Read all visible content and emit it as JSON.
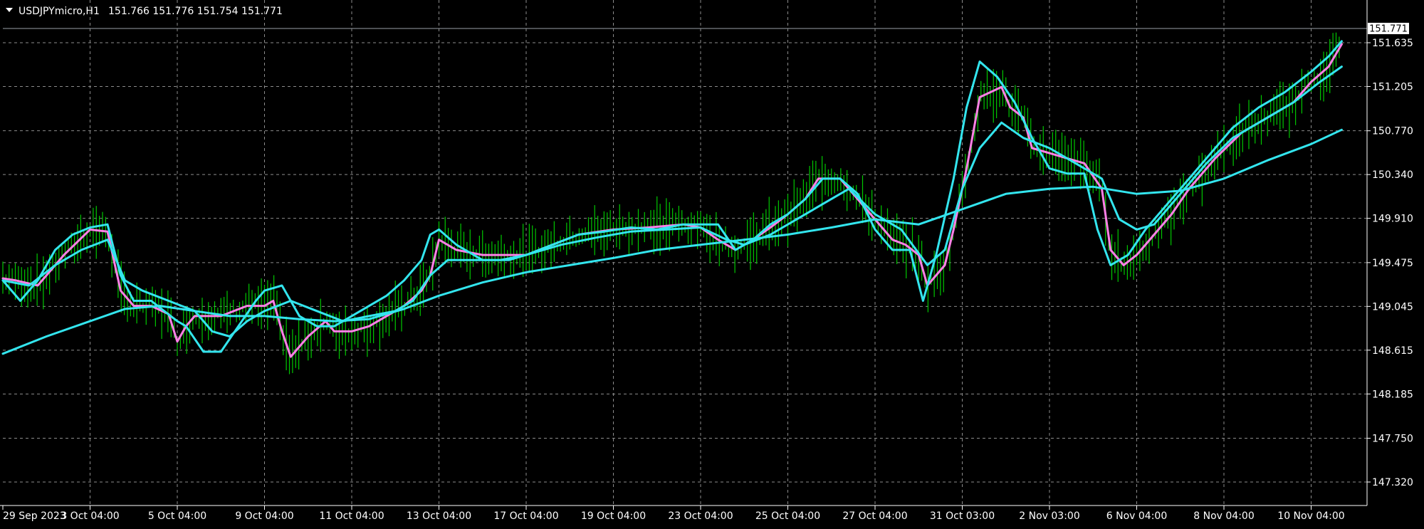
{
  "header": {
    "menu_icon": "triangle-down-icon",
    "symbol": "USDJPYmicro,H1",
    "ohlc": "151.766 151.776 151.754 151.771"
  },
  "price_tag": "151.771",
  "colors": {
    "background": "#000000",
    "grid": "#8c8c8c",
    "bars": "#00c800",
    "ma_fast": "#ff80e6",
    "ma_cyan": "#33e5ee",
    "axis_text": "#ffffff"
  },
  "chart_data": {
    "type": "line",
    "title": "USDJPYmicro,H1",
    "x_tick_labels": [
      "29 Sep 2023",
      "3 Oct 04:00",
      "5 Oct 04:00",
      "9 Oct 04:00",
      "11 Oct 04:00",
      "13 Oct 04:00",
      "17 Oct 04:00",
      "19 Oct 04:00",
      "23 Oct 04:00",
      "25 Oct 04:00",
      "27 Oct 04:00",
      "31 Oct 03:00",
      "2 Nov 03:00",
      "6 Nov 04:00",
      "8 Nov 04:00",
      "10 Nov 04:00"
    ],
    "y_tick_labels": [
      "151.635",
      "151.205",
      "150.770",
      "150.340",
      "149.910",
      "149.475",
      "149.045",
      "148.615",
      "148.185",
      "147.750",
      "147.320"
    ],
    "ylim": [
      147.16,
      151.95
    ],
    "last_price": 151.771,
    "grid": true,
    "series": [
      {
        "style": "line",
        "color": "#ff80e6",
        "points": [
          [
            0.0,
            149.32
          ],
          [
            0.15,
            149.3
          ],
          [
            0.4,
            149.25
          ],
          [
            0.7,
            149.55
          ],
          [
            1.0,
            149.8
          ],
          [
            1.2,
            149.78
          ],
          [
            1.35,
            149.2
          ],
          [
            1.5,
            149.05
          ],
          [
            1.7,
            149.05
          ],
          [
            1.9,
            148.97
          ],
          [
            2.0,
            148.7
          ],
          [
            2.1,
            148.85
          ],
          [
            2.2,
            148.95
          ],
          [
            2.5,
            148.95
          ],
          [
            2.8,
            149.05
          ],
          [
            3.0,
            149.05
          ],
          [
            3.1,
            149.1
          ],
          [
            3.2,
            148.8
          ],
          [
            3.3,
            148.55
          ],
          [
            3.5,
            148.75
          ],
          [
            3.7,
            148.9
          ],
          [
            3.8,
            148.8
          ],
          [
            4.0,
            148.8
          ],
          [
            4.2,
            148.85
          ],
          [
            4.4,
            148.95
          ],
          [
            4.6,
            149.05
          ],
          [
            4.8,
            149.2
          ],
          [
            4.9,
            149.35
          ],
          [
            5.0,
            149.7
          ],
          [
            5.2,
            149.6
          ],
          [
            5.5,
            149.55
          ],
          [
            5.8,
            149.55
          ],
          [
            6.0,
            149.55
          ],
          [
            6.3,
            149.65
          ],
          [
            6.6,
            149.75
          ],
          [
            7.0,
            149.8
          ],
          [
            7.4,
            149.82
          ],
          [
            7.8,
            149.85
          ],
          [
            8.0,
            149.82
          ],
          [
            8.2,
            149.7
          ],
          [
            8.4,
            149.6
          ],
          [
            8.6,
            149.7
          ],
          [
            8.8,
            149.82
          ],
          [
            9.0,
            149.95
          ],
          [
            9.2,
            150.1
          ],
          [
            9.35,
            150.3
          ],
          [
            9.6,
            150.3
          ],
          [
            9.8,
            150.1
          ],
          [
            10.0,
            149.9
          ],
          [
            10.2,
            149.7
          ],
          [
            10.35,
            149.65
          ],
          [
            10.5,
            149.55
          ],
          [
            10.6,
            149.25
          ],
          [
            10.8,
            149.45
          ],
          [
            10.9,
            149.8
          ],
          [
            11.05,
            150.4
          ],
          [
            11.2,
            151.1
          ],
          [
            11.45,
            151.2
          ],
          [
            11.55,
            151.0
          ],
          [
            11.7,
            150.9
          ],
          [
            11.8,
            150.6
          ],
          [
            12.0,
            150.55
          ],
          [
            12.2,
            150.5
          ],
          [
            12.4,
            150.45
          ],
          [
            12.6,
            150.2
          ],
          [
            12.7,
            149.6
          ],
          [
            12.85,
            149.45
          ],
          [
            13.0,
            149.55
          ],
          [
            13.2,
            149.75
          ],
          [
            13.4,
            149.95
          ],
          [
            13.6,
            150.2
          ],
          [
            13.9,
            150.5
          ],
          [
            14.2,
            150.75
          ],
          [
            14.5,
            150.9
          ],
          [
            14.8,
            151.05
          ],
          [
            15.0,
            151.25
          ],
          [
            15.2,
            151.4
          ],
          [
            15.35,
            151.62
          ]
        ]
      },
      {
        "style": "line",
        "color": "#33e5ee",
        "points": [
          [
            0.0,
            149.3
          ],
          [
            0.2,
            149.1
          ],
          [
            0.4,
            149.3
          ],
          [
            0.6,
            149.6
          ],
          [
            0.8,
            149.75
          ],
          [
            1.0,
            149.82
          ],
          [
            1.2,
            149.85
          ],
          [
            1.35,
            149.35
          ],
          [
            1.5,
            149.1
          ],
          [
            1.7,
            149.1
          ],
          [
            1.85,
            149.0
          ],
          [
            2.0,
            148.9
          ],
          [
            2.1,
            148.85
          ],
          [
            2.3,
            148.6
          ],
          [
            2.5,
            148.6
          ],
          [
            2.7,
            148.85
          ],
          [
            2.9,
            149.1
          ],
          [
            3.0,
            149.2
          ],
          [
            3.2,
            149.25
          ],
          [
            3.4,
            148.95
          ],
          [
            3.6,
            148.85
          ],
          [
            3.8,
            148.85
          ],
          [
            4.0,
            148.95
          ],
          [
            4.2,
            149.05
          ],
          [
            4.4,
            149.15
          ],
          [
            4.6,
            149.3
          ],
          [
            4.8,
            149.5
          ],
          [
            4.9,
            149.75
          ],
          [
            5.0,
            149.8
          ],
          [
            5.2,
            149.65
          ],
          [
            5.5,
            149.5
          ],
          [
            5.8,
            149.5
          ],
          [
            6.0,
            149.55
          ],
          [
            6.3,
            149.65
          ],
          [
            6.6,
            149.75
          ],
          [
            6.9,
            149.78
          ],
          [
            7.2,
            149.82
          ],
          [
            7.5,
            149.8
          ],
          [
            7.8,
            149.85
          ],
          [
            8.0,
            149.85
          ],
          [
            8.2,
            149.85
          ],
          [
            8.4,
            149.6
          ],
          [
            8.6,
            149.7
          ],
          [
            8.8,
            149.85
          ],
          [
            9.0,
            149.95
          ],
          [
            9.2,
            150.1
          ],
          [
            9.4,
            150.3
          ],
          [
            9.6,
            150.3
          ],
          [
            9.8,
            150.15
          ],
          [
            10.0,
            149.8
          ],
          [
            10.2,
            149.6
          ],
          [
            10.4,
            149.6
          ],
          [
            10.55,
            149.1
          ],
          [
            10.7,
            149.55
          ],
          [
            10.9,
            150.3
          ],
          [
            11.05,
            151.0
          ],
          [
            11.2,
            151.45
          ],
          [
            11.4,
            151.3
          ],
          [
            11.6,
            151.05
          ],
          [
            11.8,
            150.7
          ],
          [
            12.0,
            150.4
          ],
          [
            12.2,
            150.35
          ],
          [
            12.4,
            150.35
          ],
          [
            12.55,
            149.8
          ],
          [
            12.7,
            149.45
          ],
          [
            12.9,
            149.55
          ],
          [
            13.1,
            149.8
          ],
          [
            13.3,
            150.0
          ],
          [
            13.5,
            150.2
          ],
          [
            13.8,
            150.5
          ],
          [
            14.1,
            150.8
          ],
          [
            14.4,
            151.0
          ],
          [
            14.7,
            151.15
          ],
          [
            15.0,
            151.35
          ],
          [
            15.2,
            151.5
          ],
          [
            15.35,
            151.65
          ]
        ]
      },
      {
        "style": "line",
        "color": "#33e5ee",
        "points": [
          [
            0.0,
            149.3
          ],
          [
            0.3,
            149.25
          ],
          [
            0.6,
            149.45
          ],
          [
            0.9,
            149.6
          ],
          [
            1.2,
            149.7
          ],
          [
            1.4,
            149.3
          ],
          [
            1.6,
            149.2
          ],
          [
            1.9,
            149.1
          ],
          [
            2.2,
            149.0
          ],
          [
            2.4,
            148.8
          ],
          [
            2.6,
            148.75
          ],
          [
            2.8,
            148.9
          ],
          [
            3.0,
            149.0
          ],
          [
            3.3,
            149.1
          ],
          [
            3.6,
            149.0
          ],
          [
            3.9,
            148.9
          ],
          [
            4.2,
            148.95
          ],
          [
            4.5,
            149.0
          ],
          [
            4.7,
            149.1
          ],
          [
            4.9,
            149.35
          ],
          [
            5.1,
            149.5
          ],
          [
            5.4,
            149.5
          ],
          [
            5.7,
            149.5
          ],
          [
            6.0,
            149.55
          ],
          [
            6.4,
            149.65
          ],
          [
            6.8,
            149.72
          ],
          [
            7.2,
            149.78
          ],
          [
            7.6,
            149.8
          ],
          [
            8.0,
            149.82
          ],
          [
            8.3,
            149.7
          ],
          [
            8.5,
            149.65
          ],
          [
            8.8,
            149.75
          ],
          [
            9.1,
            149.9
          ],
          [
            9.4,
            150.05
          ],
          [
            9.7,
            150.2
          ],
          [
            10.0,
            149.95
          ],
          [
            10.3,
            149.8
          ],
          [
            10.6,
            149.45
          ],
          [
            10.8,
            149.6
          ],
          [
            11.0,
            150.2
          ],
          [
            11.2,
            150.6
          ],
          [
            11.45,
            150.85
          ],
          [
            11.7,
            150.7
          ],
          [
            12.0,
            150.6
          ],
          [
            12.3,
            150.45
          ],
          [
            12.6,
            150.3
          ],
          [
            12.8,
            149.9
          ],
          [
            13.0,
            149.8
          ],
          [
            13.2,
            149.85
          ],
          [
            13.5,
            150.15
          ],
          [
            13.8,
            150.45
          ],
          [
            14.1,
            150.7
          ],
          [
            14.5,
            150.9
          ],
          [
            14.8,
            151.05
          ],
          [
            15.1,
            151.25
          ],
          [
            15.35,
            151.4
          ]
        ]
      },
      {
        "style": "line",
        "color": "#33e5ee",
        "points": [
          [
            0.0,
            148.58
          ],
          [
            0.5,
            148.75
          ],
          [
            1.0,
            148.9
          ],
          [
            1.4,
            149.02
          ],
          [
            1.8,
            149.05
          ],
          [
            2.2,
            149.0
          ],
          [
            2.6,
            148.95
          ],
          [
            3.0,
            148.95
          ],
          [
            3.4,
            148.92
          ],
          [
            3.8,
            148.9
          ],
          [
            4.2,
            148.92
          ],
          [
            4.6,
            149.02
          ],
          [
            5.0,
            149.15
          ],
          [
            5.5,
            149.28
          ],
          [
            6.0,
            149.38
          ],
          [
            6.5,
            149.45
          ],
          [
            7.0,
            149.52
          ],
          [
            7.5,
            149.6
          ],
          [
            8.0,
            149.65
          ],
          [
            8.5,
            149.7
          ],
          [
            9.0,
            149.75
          ],
          [
            9.5,
            149.82
          ],
          [
            10.0,
            149.9
          ],
          [
            10.5,
            149.85
          ],
          [
            11.0,
            150.0
          ],
          [
            11.5,
            150.15
          ],
          [
            12.0,
            150.2
          ],
          [
            12.5,
            150.22
          ],
          [
            13.0,
            150.15
          ],
          [
            13.5,
            150.18
          ],
          [
            14.0,
            150.3
          ],
          [
            14.5,
            150.48
          ],
          [
            15.0,
            150.64
          ],
          [
            15.35,
            150.78
          ]
        ]
      }
    ]
  }
}
